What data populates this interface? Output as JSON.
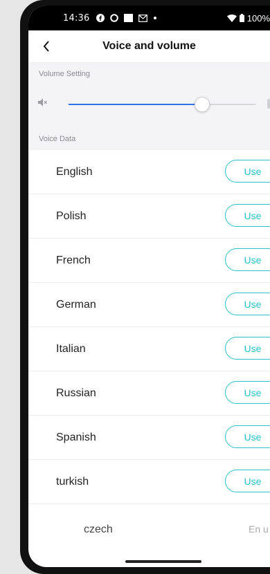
{
  "status_bar": {
    "time": "14:36",
    "battery": "100%"
  },
  "app_bar": {
    "title": "Voice and volume"
  },
  "volume_section": {
    "header": "Volume Setting",
    "level": 0.71
  },
  "voice_section": {
    "header": "Voice Data",
    "languages": [
      {
        "name": "English",
        "action": "Use"
      },
      {
        "name": "Polish",
        "action": "Use"
      },
      {
        "name": "French",
        "action": "Use"
      },
      {
        "name": "German",
        "action": "Use"
      },
      {
        "name": "Italian",
        "action": "Use"
      },
      {
        "name": "Russian",
        "action": "Use"
      },
      {
        "name": "Spanish",
        "action": "Use"
      },
      {
        "name": "turkish",
        "action": "Use"
      }
    ],
    "partial_item": {
      "name": "czech",
      "action": "En u"
    }
  },
  "colors": {
    "accent": "#27c1c9",
    "slider_fill": "#2d74e8",
    "section_bg": "#f4f4f6"
  }
}
